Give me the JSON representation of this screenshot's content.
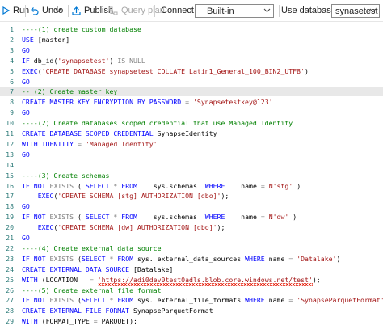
{
  "toolbar": {
    "run": "Run",
    "undo": "Undo",
    "publish": "Publish",
    "query_plan": "Query plan",
    "connect_to_label": "Connect to",
    "connect_to_value": "Built-in",
    "use_database_label": "Use database",
    "use_database_value": "synasetest"
  },
  "icons": {
    "run": "play-icon",
    "undo": "undo-icon",
    "undo_dropdown": "chevron-down-icon",
    "publish": "publish-icon",
    "query_plan": "query-plan-icon",
    "connect_chevron": "chevron-down-icon",
    "database_chevron": "chevron-down-icon"
  },
  "colors": {
    "keyword": "#0000ff",
    "string": "#a31515",
    "comment": "#008000",
    "operator": "#808080",
    "line_number": "#2b7a78",
    "error_squiggle": "#e51400"
  },
  "editor": {
    "highlighted_line": 7,
    "lines": [
      {
        "n": "1",
        "tokens": [
          {
            "t": "c",
            "v": "----(1) create custom database"
          }
        ]
      },
      {
        "n": "2",
        "tokens": [
          {
            "t": "k",
            "v": "USE "
          },
          {
            "t": "t",
            "v": "[master]"
          }
        ]
      },
      {
        "n": "3",
        "tokens": [
          {
            "t": "k",
            "v": "GO"
          }
        ]
      },
      {
        "n": "4",
        "tokens": [
          {
            "t": "k",
            "v": "IF "
          },
          {
            "t": "t",
            "v": "db_id("
          },
          {
            "t": "s",
            "v": "'synapsetest'"
          },
          {
            "t": "t",
            "v": ") "
          },
          {
            "t": "g",
            "v": "IS NULL"
          }
        ]
      },
      {
        "n": "5",
        "tokens": [
          {
            "t": "k",
            "v": "EXEC"
          },
          {
            "t": "t",
            "v": "("
          },
          {
            "t": "s",
            "v": "'CREATE DATABASE synapsetest COLLATE Latin1_General_100_BIN2_UTF8'"
          },
          {
            "t": "t",
            "v": ")"
          }
        ]
      },
      {
        "n": "6",
        "tokens": [
          {
            "t": "k",
            "v": "GO"
          }
        ]
      },
      {
        "n": "7",
        "tokens": [
          {
            "t": "c",
            "v": "-- (2) Create master key"
          }
        ]
      },
      {
        "n": "8",
        "tokens": [
          {
            "t": "k",
            "v": "CREATE MASTER KEY ENCRYPTION BY PASSWORD "
          },
          {
            "t": "g",
            "v": "= "
          },
          {
            "t": "s",
            "v": "'Synapsetestkey@123'"
          }
        ]
      },
      {
        "n": "9",
        "tokens": [
          {
            "t": "k",
            "v": "GO"
          }
        ]
      },
      {
        "n": "10",
        "tokens": [
          {
            "t": "c",
            "v": "----(2) Create databases scoped credential that use Managed Identity"
          }
        ]
      },
      {
        "n": "11",
        "tokens": [
          {
            "t": "k",
            "v": "CREATE DATABASE SCOPED CREDENTIAL "
          },
          {
            "t": "t",
            "v": "SynapseIdentity"
          }
        ]
      },
      {
        "n": "12",
        "tokens": [
          {
            "t": "k",
            "v": "WITH IDENTITY "
          },
          {
            "t": "g",
            "v": "= "
          },
          {
            "t": "s",
            "v": "'Managed Identity'"
          }
        ]
      },
      {
        "n": "13",
        "tokens": [
          {
            "t": "k",
            "v": "GO"
          }
        ]
      },
      {
        "n": "14",
        "tokens": []
      },
      {
        "n": "15",
        "tokens": [
          {
            "t": "c",
            "v": "----(3) Create schemas"
          }
        ]
      },
      {
        "n": "16",
        "tokens": [
          {
            "t": "k",
            "v": "IF NOT "
          },
          {
            "t": "g",
            "v": "EXISTS "
          },
          {
            "t": "t",
            "v": "( "
          },
          {
            "t": "k",
            "v": "SELECT "
          },
          {
            "t": "g",
            "v": "* "
          },
          {
            "t": "k",
            "v": "FROM    "
          },
          {
            "t": "t",
            "v": "sys.schemas  "
          },
          {
            "t": "k",
            "v": "WHERE    "
          },
          {
            "t": "t",
            "v": "name "
          },
          {
            "t": "g",
            "v": "= "
          },
          {
            "t": "s",
            "v": "N'stg'"
          },
          {
            "t": "t",
            "v": " )"
          }
        ]
      },
      {
        "n": "17",
        "tokens": [
          {
            "t": "t",
            "v": "    "
          },
          {
            "t": "k",
            "v": "EXEC"
          },
          {
            "t": "t",
            "v": "("
          },
          {
            "t": "s",
            "v": "'CREATE SCHEMA [stg] AUTHORIZATION [dbo]'"
          },
          {
            "t": "t",
            "v": ");"
          }
        ]
      },
      {
        "n": "18",
        "tokens": [
          {
            "t": "k",
            "v": "GO"
          }
        ]
      },
      {
        "n": "19",
        "tokens": [
          {
            "t": "k",
            "v": "IF NOT "
          },
          {
            "t": "g",
            "v": "EXISTS "
          },
          {
            "t": "t",
            "v": "( "
          },
          {
            "t": "k",
            "v": "SELECT "
          },
          {
            "t": "g",
            "v": "* "
          },
          {
            "t": "k",
            "v": "FROM    "
          },
          {
            "t": "t",
            "v": "sys.schemas  "
          },
          {
            "t": "k",
            "v": "WHERE    "
          },
          {
            "t": "t",
            "v": "name "
          },
          {
            "t": "g",
            "v": "= "
          },
          {
            "t": "s",
            "v": "N'dw'"
          },
          {
            "t": "t",
            "v": " )"
          }
        ]
      },
      {
        "n": "20",
        "tokens": [
          {
            "t": "t",
            "v": "    "
          },
          {
            "t": "k",
            "v": "EXEC"
          },
          {
            "t": "t",
            "v": "("
          },
          {
            "t": "s",
            "v": "'CREATE SCHEMA [dw] AUTHORIZATION [dbo]'"
          },
          {
            "t": "t",
            "v": ");"
          }
        ]
      },
      {
        "n": "21",
        "tokens": [
          {
            "t": "k",
            "v": "GO"
          }
        ]
      },
      {
        "n": "22",
        "tokens": [
          {
            "t": "c",
            "v": "----(4) Create external data source"
          }
        ]
      },
      {
        "n": "23",
        "tokens": [
          {
            "t": "k",
            "v": "IF NOT "
          },
          {
            "t": "g",
            "v": "EXISTS "
          },
          {
            "t": "t",
            "v": "("
          },
          {
            "t": "k",
            "v": "SELECT "
          },
          {
            "t": "g",
            "v": "* "
          },
          {
            "t": "k",
            "v": "FROM "
          },
          {
            "t": "t",
            "v": "sys. external_data_sources "
          },
          {
            "t": "k",
            "v": "WHERE "
          },
          {
            "t": "t",
            "v": "name "
          },
          {
            "t": "g",
            "v": "= "
          },
          {
            "t": "s",
            "v": "'Datalake'"
          },
          {
            "t": "t",
            "v": ")"
          }
        ]
      },
      {
        "n": "24",
        "tokens": [
          {
            "t": "k",
            "v": "CREATE EXTERNAL DATA SOURCE "
          },
          {
            "t": "t",
            "v": "[Datalake]"
          }
        ]
      },
      {
        "n": "25",
        "tokens": [
          {
            "t": "k",
            "v": "WITH "
          },
          {
            "t": "t",
            "v": "(LOCATION   "
          },
          {
            "t": "g",
            "v": "= "
          },
          {
            "t": "s",
            "v": "'https://adi0dev0test0adls.blob.core.windows.net/test'"
          },
          {
            "t": "t",
            "v": ");"
          }
        ]
      },
      {
        "n": "26",
        "tokens": [
          {
            "t": "c",
            "v": "----(5) Create external file format"
          }
        ]
      },
      {
        "n": "27",
        "tokens": [
          {
            "t": "k",
            "v": "IF NOT "
          },
          {
            "t": "g",
            "v": "EXISTS "
          },
          {
            "t": "t",
            "v": "("
          },
          {
            "t": "k",
            "v": "SELECT "
          },
          {
            "t": "g",
            "v": "* "
          },
          {
            "t": "k",
            "v": "FROM "
          },
          {
            "t": "t",
            "v": "sys. external_file_formats "
          },
          {
            "t": "k",
            "v": "WHERE "
          },
          {
            "t": "t",
            "v": "name "
          },
          {
            "t": "g",
            "v": "= "
          },
          {
            "t": "s",
            "v": "'SynapseParquetFormat'"
          },
          {
            "t": "t",
            "v": ")"
          }
        ]
      },
      {
        "n": "28",
        "tokens": [
          {
            "t": "k",
            "v": "CREATE EXTERNAL FILE FORMAT "
          },
          {
            "t": "t",
            "v": "SynapseParquetFormat"
          }
        ]
      },
      {
        "n": "29",
        "tokens": [
          {
            "t": "k",
            "v": "WITH "
          },
          {
            "t": "t",
            "v": "(FORMAT_TYPE "
          },
          {
            "t": "g",
            "v": "= "
          },
          {
            "t": "t",
            "v": "PARQUET);"
          }
        ]
      }
    ]
  }
}
